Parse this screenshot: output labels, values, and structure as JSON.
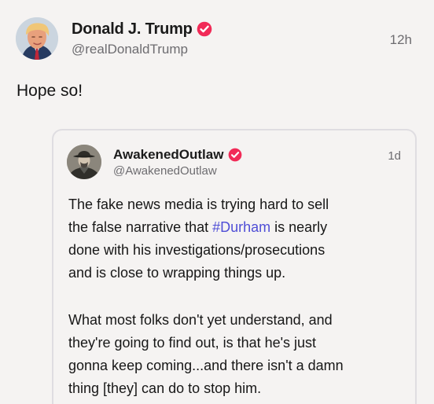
{
  "post": {
    "author": {
      "display_name": "Donald J. Trump",
      "handle": "@realDonaldTrump",
      "verified_icon": "verified-badge-icon"
    },
    "timestamp": "12h",
    "text": "Hope so!"
  },
  "quoted_post": {
    "author": {
      "display_name": "AwakenedOutlaw",
      "handle": "@AwakenedOutlaw",
      "verified_icon": "verified-badge-icon"
    },
    "timestamp": "1d",
    "paragraph_1": {
      "line_1": "The fake news media is trying hard to sell",
      "line_2_before": "the false narrative that ",
      "hashtag": "#Durham",
      "line_2_after": " is nearly",
      "line_3": "done with his investigations/prosecutions",
      "line_4": "and is close to wrapping things up."
    },
    "paragraph_2": {
      "line_1": "What most folks don't yet understand, and",
      "line_2": "they're going to find out, is that he's just",
      "line_3": "gonna keep coming...and there isn't a damn",
      "line_4": "thing [they] can do to stop him."
    }
  },
  "colors": {
    "background": "#f5f3f2",
    "verified_badge": "#f12a57",
    "hashtag": "#4f4ed6",
    "muted_text": "#6d6c70",
    "quote_border": "#dfdde1"
  }
}
